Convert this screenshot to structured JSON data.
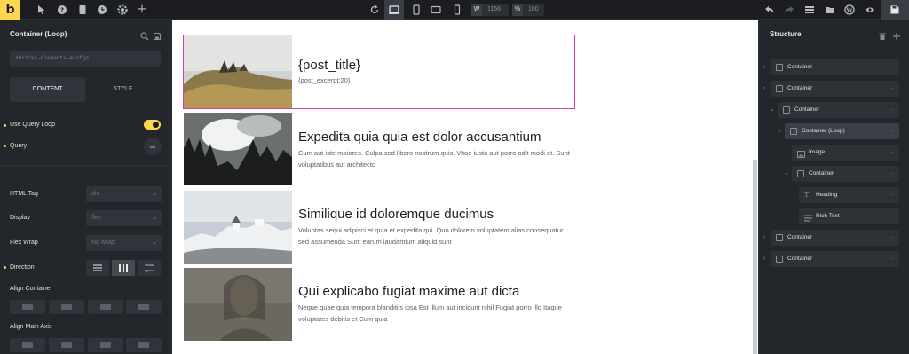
{
  "topbar": {
    "logo": "b",
    "width_label": "W",
    "width_value": "1156",
    "percent_label": "%",
    "percent_value": "100"
  },
  "left_panel": {
    "title": "Container (Loop)",
    "element_id": "#bricks-elements-euofgq",
    "tabs": [
      "CONTENT",
      "STYLE"
    ],
    "use_query_loop": "Use Query Loop",
    "query": "Query",
    "html_tag": {
      "label": "HTML Tag",
      "value": "div"
    },
    "display": {
      "label": "Display",
      "value": "flex"
    },
    "flex_wrap": {
      "label": "Flex Wrap",
      "value": "No wrap"
    },
    "direction": "Direction",
    "align_container": "Align Container",
    "align_main_axis": "Align Main Axis"
  },
  "posts": [
    {
      "title": "{post_title}",
      "excerpt": "{post_excerpt:20}"
    },
    {
      "title": "Expedita quia quia est dolor accusantium",
      "excerpt": "Cum aut iste maiores. Culpa sed libero nostrum quis. Vitae iusto aut porro odit modi et. Sunt voluptatibus aut architecto"
    },
    {
      "title": "Similique id doloremque ducimus",
      "excerpt": "Voluptas sequi adipisci et quia et expedita qui. Quo dolorem voluptatem alias consequatur sed assumenda Sunt earum laudantium aliquid sunt"
    },
    {
      "title": "Qui explicabo fugiat maxime aut dicta",
      "excerpt": "Neque quae quia tempora blanditiis ipsa Est illum aut incidunt nihil Fugiat porro illo Itaque voluptates debitis et Cum quia"
    }
  ],
  "structure": {
    "title": "Structure",
    "nodes": [
      "Container",
      "Container",
      "Container",
      "Container (Loop)",
      "Image",
      "Container",
      "Heading",
      "Rich Text",
      "Container",
      "Container"
    ],
    "more": "···"
  },
  "colors": {
    "accent": "#ffd64f",
    "selection": "#d63aa0"
  }
}
